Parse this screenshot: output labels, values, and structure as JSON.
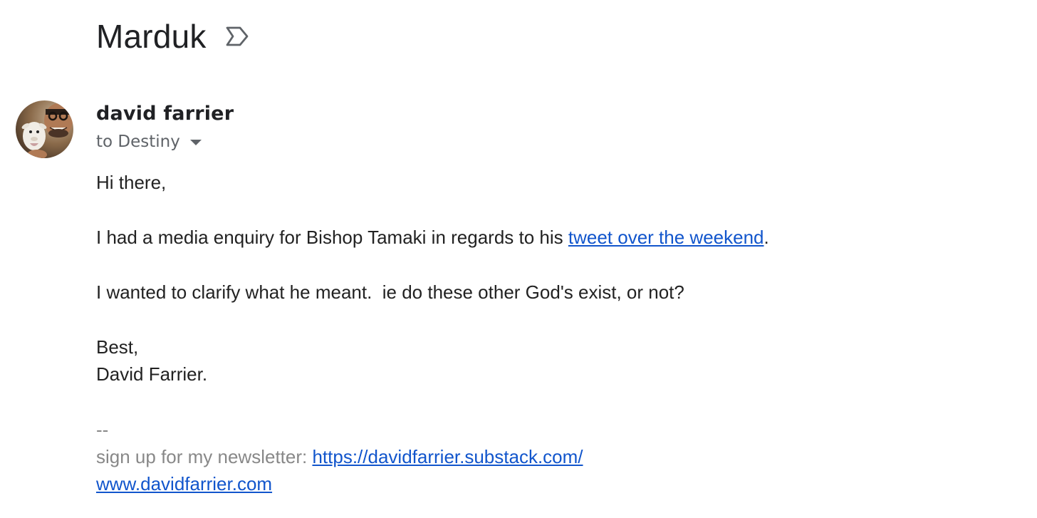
{
  "email": {
    "subject": "Marduk",
    "sender": "david farrier",
    "recipient": "to Destiny",
    "greeting": "Hi there,",
    "para1_before": "I had a media enquiry for Bishop Tamaki in regards to his ",
    "para1_link": "tweet over the weekend",
    "para1_after": ".",
    "para2": "I wanted to clarify what he meant.  ie do these other God's exist, or not?",
    "closing": "Best,",
    "name": "David Farrier.",
    "sig_dash": "--",
    "sig_newsletter_label": "sign up for my newsletter: ",
    "sig_newsletter_link": "https://davidfarrier.substack.com/",
    "sig_site_link": "www.davidfarrier.com"
  },
  "icons": {
    "important": "label-important-icon",
    "recipient_caret": "caret-down-icon"
  },
  "colors": {
    "link": "#1155cc",
    "text": "#222222",
    "muted": "#5f6368",
    "signature": "#888888"
  }
}
